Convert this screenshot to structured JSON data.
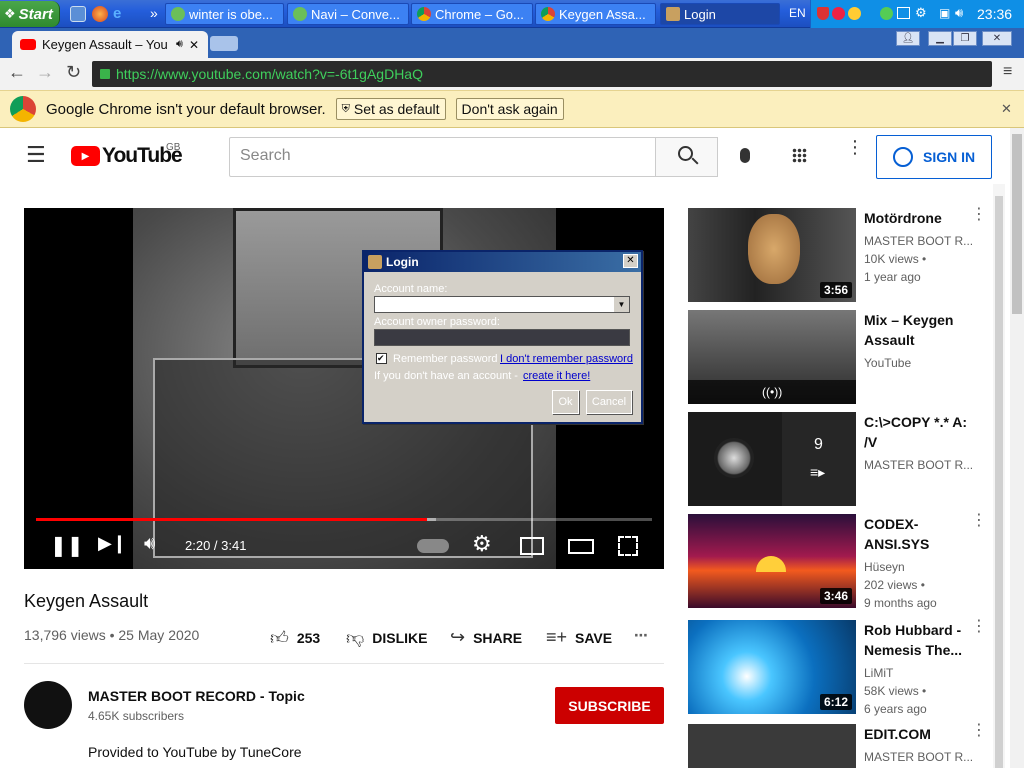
{
  "taskbar": {
    "start_label": "Start",
    "tasks": [
      {
        "label": "winter is obe..."
      },
      {
        "label": "Navi – Conve..."
      },
      {
        "label": "Chrome – Go..."
      },
      {
        "label": "Keygen Assa..."
      },
      {
        "label": "Login"
      }
    ],
    "lang": "EN",
    "clock": "23:36"
  },
  "browser": {
    "tab_title": "Keygen Assault – You",
    "url": "https://www.youtube.com/watch?v=-6t1gAgDHaQ",
    "infobar_text": "Google Chrome isn't your default browser.",
    "set_default": "Set as default",
    "dont_ask": "Don't ask again"
  },
  "masthead": {
    "logo": "YouTube",
    "region": "GB",
    "search_placeholder": "Search",
    "signin": "SIGN IN"
  },
  "player": {
    "time": "2:20 / 3:41",
    "progress": 0.634,
    "buffered": 0.65
  },
  "login_dialog": {
    "title": "Login",
    "account_label": "Account name:",
    "password_label": "Account owner password:",
    "remember": "Remember password",
    "forgot": "I don't remember password",
    "no_account": "If you don't have an account -",
    "create": "create it here!",
    "ok": "Ok",
    "cancel": "Cancel"
  },
  "video": {
    "title": "Keygen Assault",
    "meta": "13,796 views • 25 May 2020",
    "likes": "253",
    "dislike": "DISLIKE",
    "share": "SHARE",
    "save": "SAVE",
    "channel": "MASTER BOOT RECORD - Topic",
    "subs": "4.65K subscribers",
    "subscribe": "SUBSCRIBE",
    "description": "Provided to YouTube by TuneCore"
  },
  "recommendations": [
    {
      "title": "Motördrone",
      "channel": "MASTER BOOT R...",
      "views": "10K views •",
      "age": "1 year ago",
      "duration": "3:56"
    },
    {
      "title": "Mix – Keygen Assault",
      "channel": "YouTube",
      "views": "",
      "age": "",
      "duration": "((•))"
    },
    {
      "title": "C:\\>COPY *.* A: /V",
      "channel": "MASTER BOOT R...",
      "views": "",
      "age": "",
      "duration": "9"
    },
    {
      "title": "CODEX-ANSI.SYS",
      "channel": "Hüseyn",
      "views": "202 views •",
      "age": "9 months ago",
      "duration": "3:46"
    },
    {
      "title": "Rob Hubbard - Nemesis The...",
      "channel": "LiMiT",
      "views": "58K views •",
      "age": "6 years ago",
      "duration": "6:12"
    },
    {
      "title": "EDIT.COM",
      "channel": "MASTER BOOT R...",
      "views": "",
      "age": "",
      "duration": ""
    }
  ]
}
